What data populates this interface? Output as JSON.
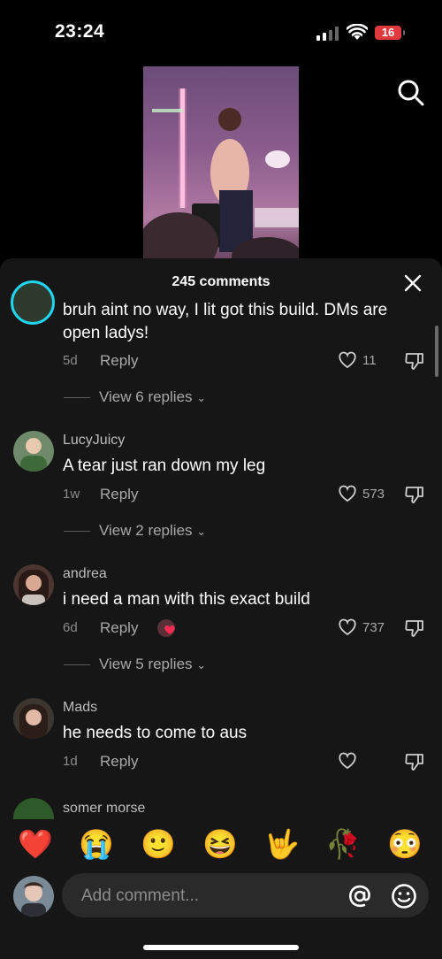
{
  "status_bar": {
    "time": "23:24",
    "battery": "16"
  },
  "comments_sheet": {
    "title": "245 comments"
  },
  "comments": [
    {
      "username": "",
      "text": "bruh aint no way, I lit got this build. DMs are open ladys!",
      "age": "5d",
      "reply_label": "Reply",
      "likes": "11",
      "view_replies": "View 6 replies"
    },
    {
      "username": "LucyJuicy",
      "text": "A tear just ran down my leg",
      "age": "1w",
      "reply_label": "Reply",
      "likes": "573",
      "view_replies": "View 2 replies"
    },
    {
      "username": "andrea",
      "text": "i need a man with this exact build",
      "age": "6d",
      "reply_label": "Reply",
      "likes": "737",
      "view_replies": "View 5 replies"
    },
    {
      "username": "Mads",
      "text": "he needs to come to aus",
      "age": "1d",
      "reply_label": "Reply",
      "likes": ""
    },
    {
      "username": "somer morse"
    }
  ],
  "emoji_bar": [
    "❤️",
    "😭",
    "🙂",
    "😆",
    "🤟",
    "🥀",
    "😳"
  ],
  "composer": {
    "placeholder": "Add comment..."
  },
  "colors": {
    "background": "#000000",
    "sheet": "#161616",
    "battery_low": "#e0393e",
    "input": "#2a2a2a"
  }
}
